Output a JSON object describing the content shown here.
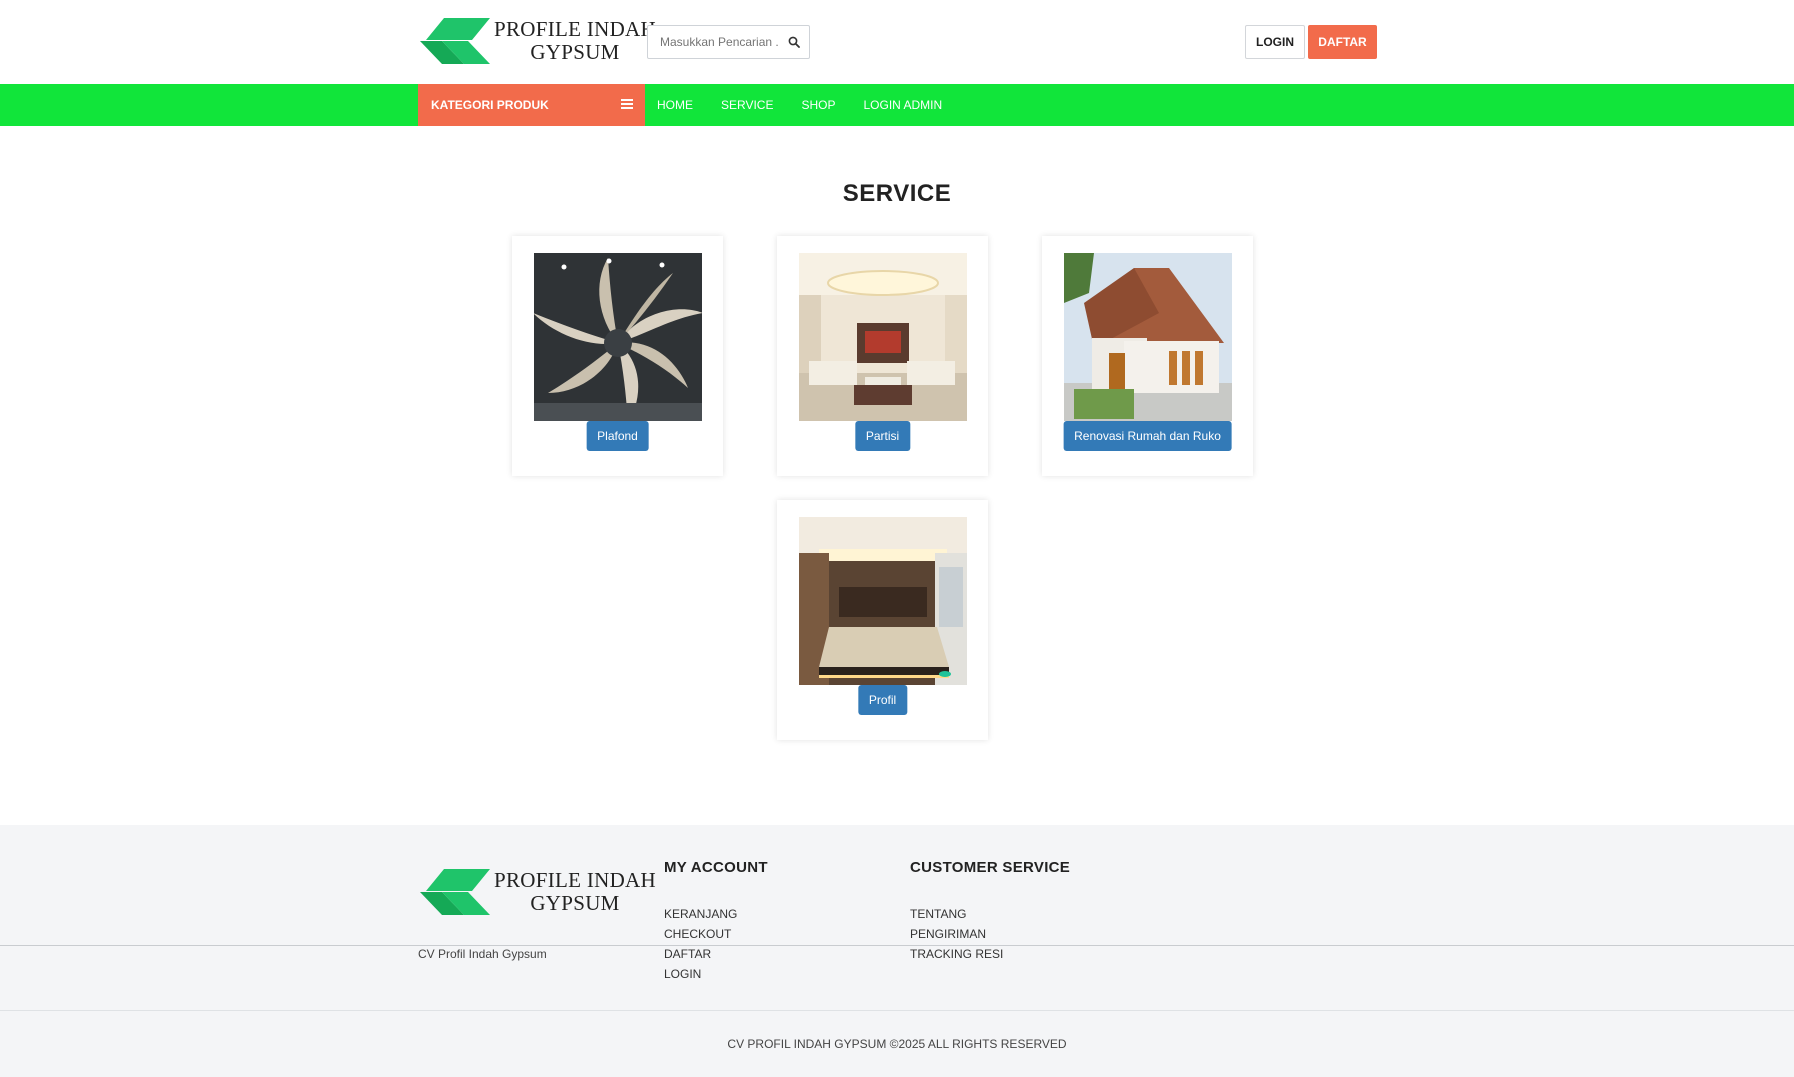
{
  "brand": {
    "name_line1": "PROFILE INDAH",
    "name_line2": "GYPSUM",
    "logo_color_dark": "#17b35a",
    "logo_color_light": "#22cc6a"
  },
  "search": {
    "placeholder": "Masukkan Pencarian ...",
    "icon": "search-icon"
  },
  "auth": {
    "login_label": "LOGIN",
    "daftar_label": "DAFTAR"
  },
  "nav": {
    "kategori_label": "KATEGORI PRODUK",
    "kategori_icon": "list-icon",
    "links": [
      "HOME",
      "SERVICE",
      "SHOP",
      "LOGIN ADMIN"
    ]
  },
  "colors": {
    "nav_green": "#11e53a",
    "accent_orange": "#f26b4b",
    "button_blue": "#337ab7"
  },
  "section": {
    "title": "SERVICE"
  },
  "services": [
    {
      "label": "Plafond",
      "image": "spiral-ceiling-image"
    },
    {
      "label": "Partisi",
      "image": "living-room-image"
    },
    {
      "label": "Renovasi Rumah dan Ruko",
      "image": "house-image"
    },
    {
      "label": "Profil",
      "image": "bedroom-image"
    }
  ],
  "footer": {
    "company": "CV Profil Indah Gypsum",
    "my_account": {
      "title": "MY ACCOUNT",
      "links": [
        "KERANJANG",
        "CHECKOUT",
        "DAFTAR",
        "LOGIN"
      ]
    },
    "customer_service": {
      "title": "CUSTOMER SERVICE",
      "links": [
        "TENTANG",
        "PENGIRIMAN",
        "TRACKING RESI"
      ]
    },
    "copyright": "CV PROFIL INDAH GYPSUM ©2025 ALL RIGHTS RESERVED"
  }
}
